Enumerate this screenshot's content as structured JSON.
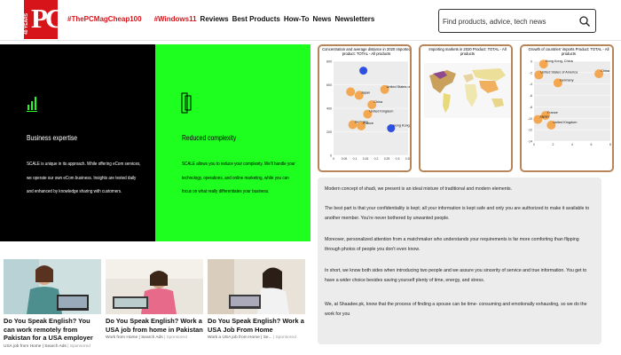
{
  "brand": {
    "logo_text": "PC",
    "logo_side_text": "40 YEARS"
  },
  "nav": {
    "items": [
      {
        "label": "#ThePCMagCheap100",
        "hashtag": true
      },
      {
        "label": "#Windows11",
        "hashtag": true
      },
      {
        "label": "Reviews",
        "hashtag": false
      },
      {
        "label": "Best Products",
        "hashtag": false
      },
      {
        "label": "How-To",
        "hashtag": false
      },
      {
        "label": "News",
        "hashtag": false
      },
      {
        "label": "Newsletters",
        "hashtag": false
      }
    ]
  },
  "search": {
    "placeholder": "Find products, advice, tech news",
    "icon": "search-icon"
  },
  "features": [
    {
      "icon": "bar-chart-icon",
      "heading": "Business expertise",
      "text": "SCALE is unique in its approach. While offering eCom services, we operate our own eCom business. Insights are tested daily and enhanced by knowledge sharing with customers.",
      "background": "#000000"
    },
    {
      "icon": "layers-icon",
      "heading": "Reduced complexity",
      "text": "SCALE allows you to reduce your complexity. We'll handle your technology, operations, and online marketing, while you can focus on what really differentiates your business.",
      "background": "#1fff1f"
    }
  ],
  "charts": [
    {
      "title": "Concentration and average distance in 2020 Imported product: TOTAL - All products",
      "chart_data": {
        "type": "scatter",
        "ylim": [
          0,
          800
        ],
        "yticks": [
          0,
          200,
          400,
          600,
          800
        ],
        "xticks": [
          "0",
          "0.05",
          "0.1",
          "0.15",
          "0.2",
          "0.25",
          "0.3",
          "0.35"
        ],
        "points": [
          {
            "x": 0.14,
            "y": 720,
            "label": "",
            "color": "blue"
          },
          {
            "x": 0.24,
            "y": 560,
            "label": "United States of America",
            "color": "orange"
          },
          {
            "x": 0.08,
            "y": 540,
            "label": "",
            "color": "orange"
          },
          {
            "x": 0.12,
            "y": 510,
            "label": "Japan",
            "color": "orange"
          },
          {
            "x": 0.18,
            "y": 430,
            "label": "China",
            "color": "orange"
          },
          {
            "x": 0.16,
            "y": 350,
            "label": "United Kingdom",
            "color": "orange"
          },
          {
            "x": 0.09,
            "y": 260,
            "label": "Germany",
            "color": "orange"
          },
          {
            "x": 0.13,
            "y": 250,
            "label": "France",
            "color": "orange"
          },
          {
            "x": 0.27,
            "y": 230,
            "label": "Hong Kong, China",
            "color": "blue"
          }
        ]
      }
    },
    {
      "title": "Importing markets in 2020 Product: TOTAL - All products",
      "map_label": "World map",
      "highlight_regions": [
        "Canada",
        "United States of America",
        "Russian Federation",
        "China"
      ]
    },
    {
      "title": "Growth of countries' imports Product: TOTAL - All products",
      "chart_data": {
        "type": "scatter",
        "ylim": [
          -14,
          0
        ],
        "yticks": [
          0,
          -2,
          -4,
          -6,
          -8,
          -10,
          -12,
          -14
        ],
        "xticks": [
          "0",
          "2",
          "4",
          "6",
          "8"
        ],
        "points": [
          {
            "x": 1,
            "y": -0.5,
            "label": "Hong Kong, China",
            "color": "orange"
          },
          {
            "x": 6.8,
            "y": -2.2,
            "label": "China",
            "color": "orange"
          },
          {
            "x": 0.5,
            "y": -2.4,
            "label": "United States of America",
            "color": "orange"
          },
          {
            "x": 2.5,
            "y": -3.8,
            "label": "Germany",
            "color": "orange"
          },
          {
            "x": 1.2,
            "y": -9.5,
            "label": "France",
            "color": "orange"
          },
          {
            "x": 0.4,
            "y": -10.2,
            "label": "Japan",
            "color": "orange"
          },
          {
            "x": 1.8,
            "y": -11.2,
            "label": "United Kingdom",
            "color": "orange"
          }
        ]
      }
    }
  ],
  "article": {
    "paragraphs": [
      "Modern concept of shadi, we present is an ideal mixture of traditional and modern elements.",
      "The best part is that your confidentiality is kept; all your information is kept safe and only you are authorized to make it available to another member. You're never bothered by unwanted people.",
      "Moreover, personalized attention from a matchmaker who understands your requirements is far more comforting than flipping through photos of people you don't even know.",
      "In short, we know both sides when introducing two people and we assure you sincerity of service and true information. You get to have a wider choice besides saving yourself plenty of time, energy, and stress.",
      "We, at Shaadee.pk, know that the process of finding a spouse can be time- consuming and emotionally exhausting, so we do the work for you"
    ]
  },
  "cards": [
    {
      "title": "Do You Speak English? You can work remotely from Pakistan for a USA employer",
      "source": "USA job from Home | Search Ads",
      "sponsored": "| Sponsored"
    },
    {
      "title": "Do You Speak English? Work a USA job from home in Pakistan",
      "source": "Work from Home | Search Ads",
      "sponsored": "| Sponsored"
    },
    {
      "title": "Do You Speak English? Work a USA Job From Home",
      "source": "Work a USA job from Home | Se...",
      "sponsored": "| Sponsored"
    }
  ],
  "colors": {
    "brand_red": "#d7141a",
    "green_panel": "#1fff1f",
    "chart_border": "#b8845a",
    "bubble_orange": "#f4a040",
    "bubble_blue": "#1a3fe0"
  }
}
